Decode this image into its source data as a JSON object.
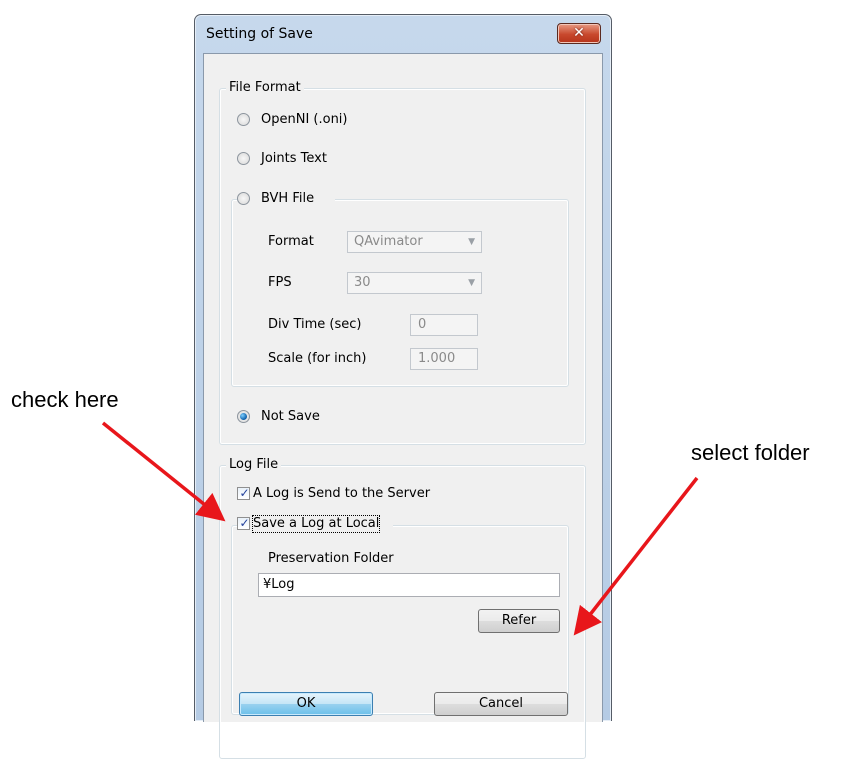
{
  "window": {
    "title": "Setting of Save",
    "close_glyph": "✕"
  },
  "file_format": {
    "label": "File Format",
    "options": [
      {
        "label": "OpenNI (.oni)",
        "checked": false
      },
      {
        "label": "Joints Text",
        "checked": false
      },
      {
        "label": "BVH File",
        "checked": false
      },
      {
        "label": "Not Save",
        "checked": true
      }
    ],
    "bvh": {
      "format_label": "Format",
      "format_value": "QAvimator",
      "fps_label": "FPS",
      "fps_value": "30",
      "div_time_label": "Div Time (sec)",
      "div_time_value": "0",
      "scale_label": "Scale (for inch)",
      "scale_value": "1.000"
    }
  },
  "log_file": {
    "label": "Log File",
    "send_to_server_label": "A Log is Send to the Server",
    "send_to_server_checked": true,
    "save_local_label": "Save a Log at Local",
    "save_local_checked": true,
    "folder_label": "Preservation Folder",
    "folder_value": "¥Log",
    "refer_label": "Refer"
  },
  "buttons": {
    "ok_label": "OK",
    "cancel_label": "Cancel"
  },
  "annotations": {
    "check_here": "check here",
    "select_folder": "select folder",
    "arrow_color": "#e8161b"
  },
  "icons": {
    "dropdown": "▼",
    "check": "✓"
  }
}
